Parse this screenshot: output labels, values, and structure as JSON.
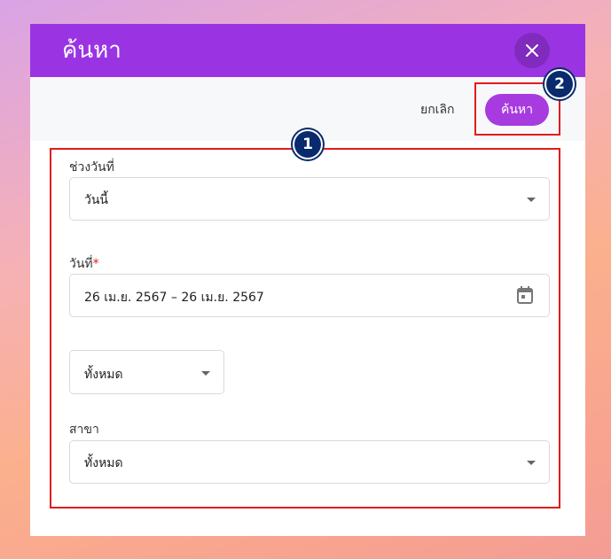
{
  "dialog": {
    "title": "ค้นหา",
    "close_icon": "close-icon",
    "actions": {
      "cancel_label": "ยกเลิก",
      "search_label": "ค้นหา"
    }
  },
  "form": {
    "date_range": {
      "label": "ช่วงวันที่",
      "value": "วันนี้"
    },
    "date": {
      "label": "วันที่",
      "required_mark": "*",
      "value": "26 เม.ย. 2567 – 26 เม.ย. 2567",
      "icon": "calendar-icon"
    },
    "filter": {
      "value": "ทั้งหมด"
    },
    "branch": {
      "label": "สาขา",
      "value": "ทั้งหมด"
    }
  },
  "annotations": {
    "badge_1": "1",
    "badge_2": "2",
    "box_color": "#e21b1b",
    "badge_color": "#0a2a6e"
  },
  "colors": {
    "header": "#9a34e3",
    "primary_button": "#a83be0"
  }
}
